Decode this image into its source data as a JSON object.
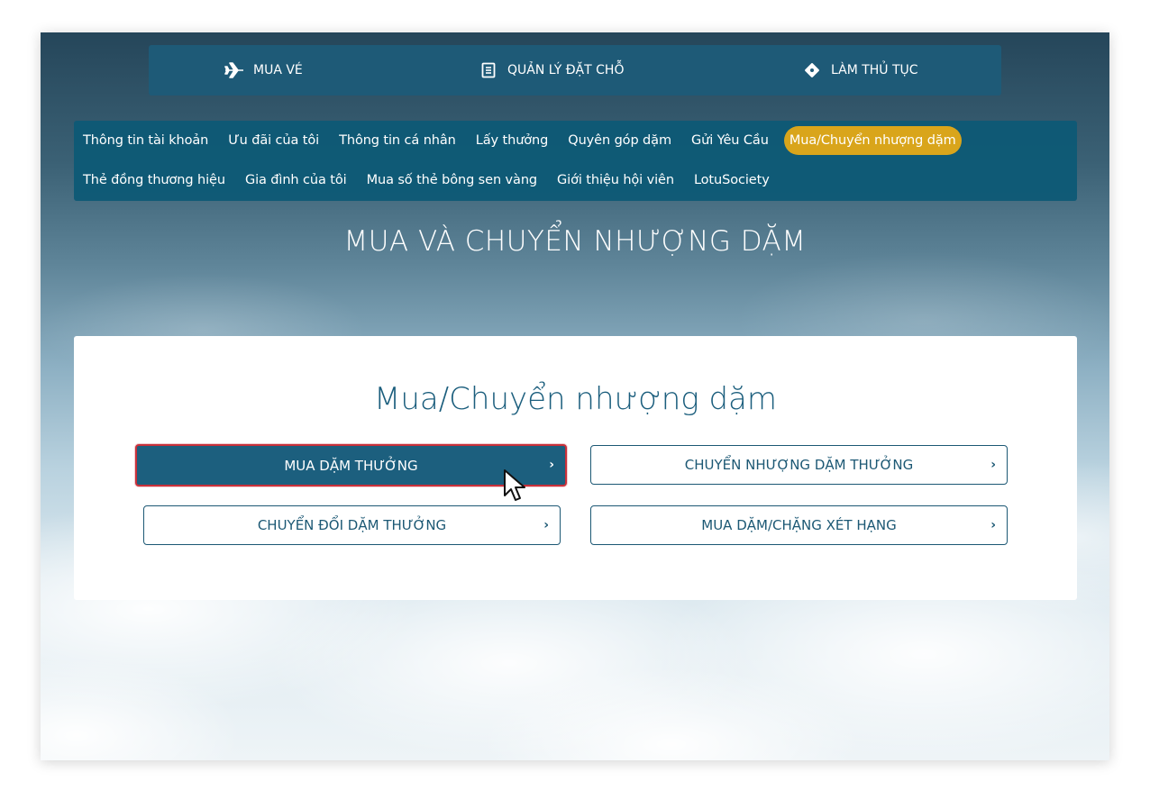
{
  "topbar": {
    "items": [
      {
        "label": "MUA VÉ",
        "icon": "airplane-icon"
      },
      {
        "label": "QUẢN LÝ ĐẶT CHỖ",
        "icon": "booking-document-icon"
      },
      {
        "label": "LÀM THỦ TỤC",
        "icon": "boarding-pass-icon"
      }
    ]
  },
  "account_nav": {
    "row1": [
      "Thông tin tài khoản",
      "Ưu đãi của tôi",
      "Thông tin cá nhân",
      "Lấy thưởng",
      "Quyên góp dặm",
      "Gửi Yêu Cầu",
      "Mua/Chuyển nhượng dặm"
    ],
    "row2": [
      "Thẻ đồng thương hiệu",
      "Gia đình của tôi",
      "Mua số thẻ bông sen vàng",
      "Giới thiệu hội viên",
      "LotuSociety"
    ],
    "active": "Mua/Chuyển nhượng dặm",
    "active_color": "#d9a51b"
  },
  "page": {
    "title": "MUA VÀ CHUYỂN NHƯỢNG DẶM"
  },
  "card": {
    "title": "Mua/Chuyển nhượng dặm",
    "options": [
      {
        "label": "MUA DẶM THƯỞNG",
        "chevron": "›"
      },
      {
        "label": "CHUYỂN NHƯỢNG DẶM THƯỞNG",
        "chevron": "›"
      },
      {
        "label": "CHUYỂN ĐỔI DẶM THƯỞNG",
        "chevron": "›"
      },
      {
        "label": "MUA DẶM/CHẶNG XÉT HẠNG",
        "chevron": "›"
      }
    ]
  },
  "colors": {
    "brand": "#1e5a77",
    "highlight_border": "#c8303a"
  }
}
